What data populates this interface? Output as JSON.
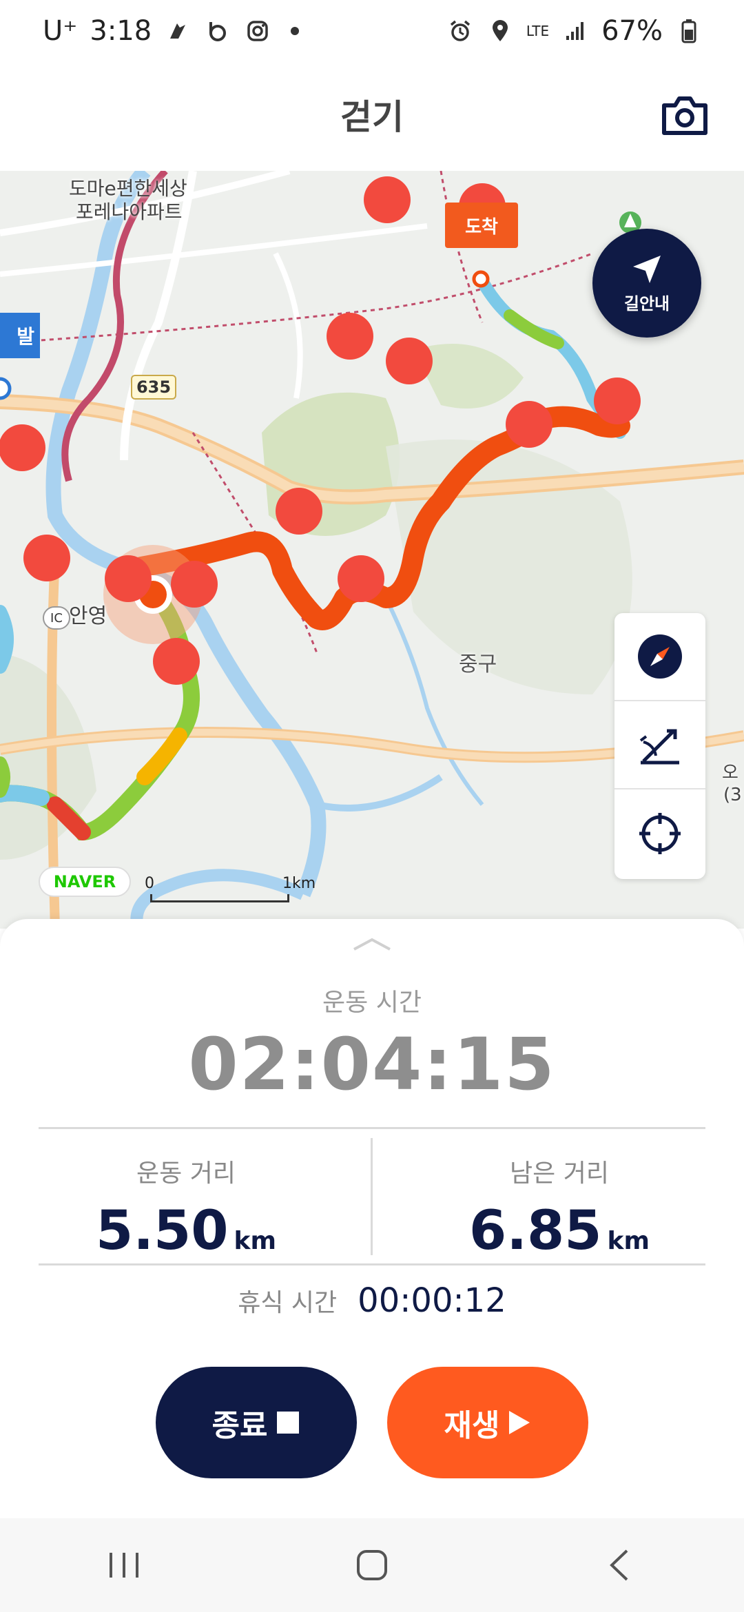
{
  "status_bar": {
    "carrier": "U⁺",
    "time": "3:18",
    "network": "LTE",
    "battery": "67%"
  },
  "header": {
    "title": "걷기"
  },
  "map": {
    "navigate_label": "길안내",
    "arrival_label": "도착",
    "departure_label": "발",
    "road_number": "635",
    "ic_badge": "IC",
    "place_labels": {
      "apartment_1": "도마e편한세상",
      "apartment_2": "포레나아파트",
      "anyeong": "안영",
      "junggu": "중구"
    },
    "edge_labels": {
      "right_1": "오",
      "right_2": "(3"
    },
    "naver": "NAVER",
    "scale_start": "0",
    "scale_end": "1km"
  },
  "stats": {
    "exercise_time_label": "운동 시간",
    "exercise_time": "02:04:15",
    "distance_label": "운동 거리",
    "distance_value": "5.50",
    "distance_unit": "km",
    "remaining_label": "남은 거리",
    "remaining_value": "6.85",
    "remaining_unit": "km",
    "rest_label": "휴식 시간",
    "rest_value": "00:00:12"
  },
  "controls": {
    "stop_label": "종료",
    "play_label": "재생"
  },
  "colors": {
    "navy": "#0f1a45",
    "orange": "#ff5a1f",
    "route_orange": "#f04e10"
  }
}
